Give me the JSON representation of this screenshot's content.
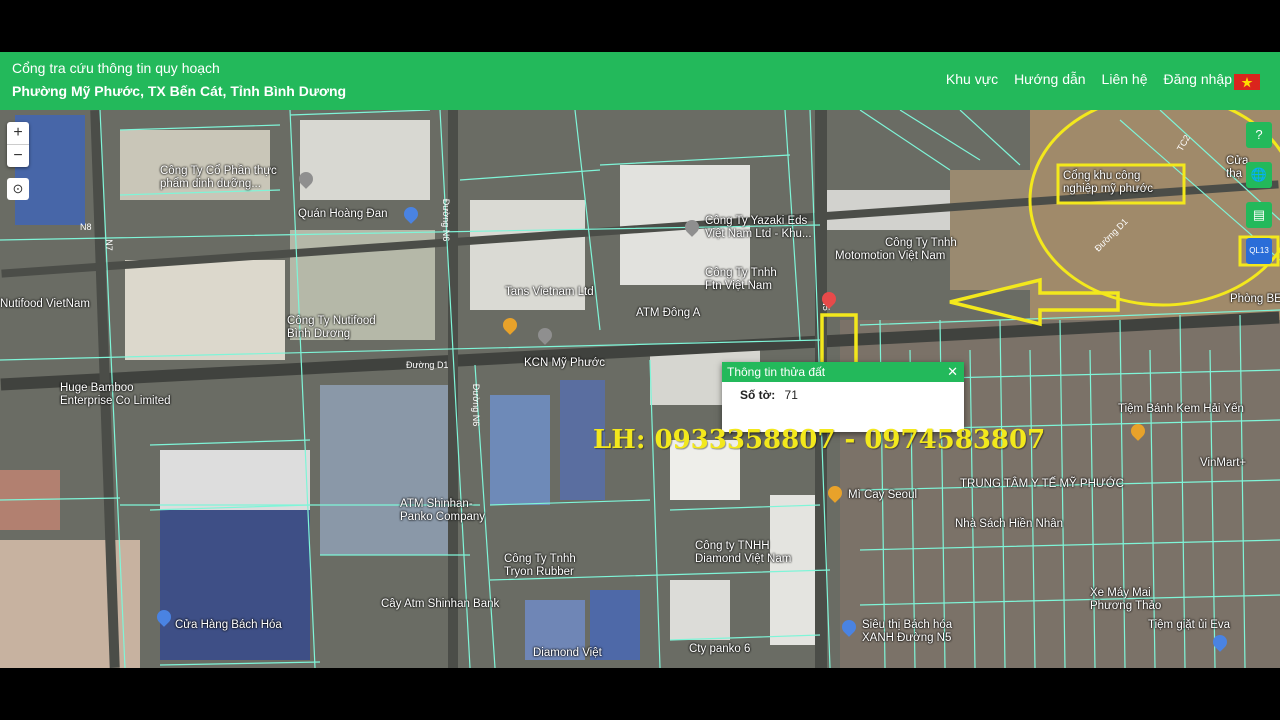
{
  "header": {
    "title_line1": "Cổng tra cứu thông tin quy hoạch",
    "title_line2": "Phường Mỹ Phước, TX Bến Cát, Tỉnh Bình Dương",
    "nav": [
      "Khu vực",
      "Hướng dẫn",
      "Liên hệ",
      "Đăng nhập"
    ]
  },
  "map": {
    "zoom_in": "+",
    "zoom_out": "−",
    "locate_icon": "⊙",
    "right_controls": [
      "?",
      "🌐",
      "▤"
    ],
    "badge": "QL13",
    "highlight_label": "Cổng khu công nghiệp mỹ phước",
    "labels": [
      "Công Ty Cổ Phần thực phẩm dinh dưỡng...",
      "Quán Hoàng Đan",
      "Nutifood VietNam",
      "Công Ty Nutifood Bình Dương",
      "Tans Vietnam Ltd",
      "Công Ty Yazaki Eds Việt Nam Ltd - Khu...",
      "Công Ty Tnhh Ftn Việt Nam",
      "ATM Đông A",
      "Motomotion Việt Nam",
      "Công Ty Tnhh",
      "KCN Mỹ Phước",
      "Huge Bamboo Enterprise Co Limited",
      "ATM Shinhan-Panko Company",
      "Công Ty Tnhh Tryon Rubber",
      "Công ty TNHH Diamond Việt Nam",
      "Cây Atm Shinhan Bank",
      "Cửa Hàng Bách Hóa",
      "Diamond Việt Nam Co.,Ltd",
      "Cty panko 6",
      "Siêu thị Bách hóa XANH Đường N5",
      "Tiệm Bánh Kem Hải Yến",
      "TRUNG TÂM Y TẾ MỸ PHƯỚC",
      "Xe Máy Mai Phương Thảo",
      "Tiệm giặt ủi Eva",
      "Mì Cay Seoul",
      "Nhà Sách Hiền Nhân",
      "VinMart+",
      "Cửa thạ",
      "Phòng BE"
    ],
    "roads": [
      "N8",
      "N7",
      "Đường N6",
      "Đường D1",
      "Đường D1",
      "TC2",
      "Đường N6",
      "N5"
    ]
  },
  "popup": {
    "title": "Thông tin thửa đất",
    "close": "✕",
    "field_label": "Số tờ:",
    "field_value": "71"
  },
  "overlay": {
    "contact": "LH: 0933358807 - 0974583807"
  },
  "colors": {
    "brand_green": "#23b95b",
    "parcel_line": "#7ff5d8",
    "annotation_yellow": "#f3e81c"
  }
}
